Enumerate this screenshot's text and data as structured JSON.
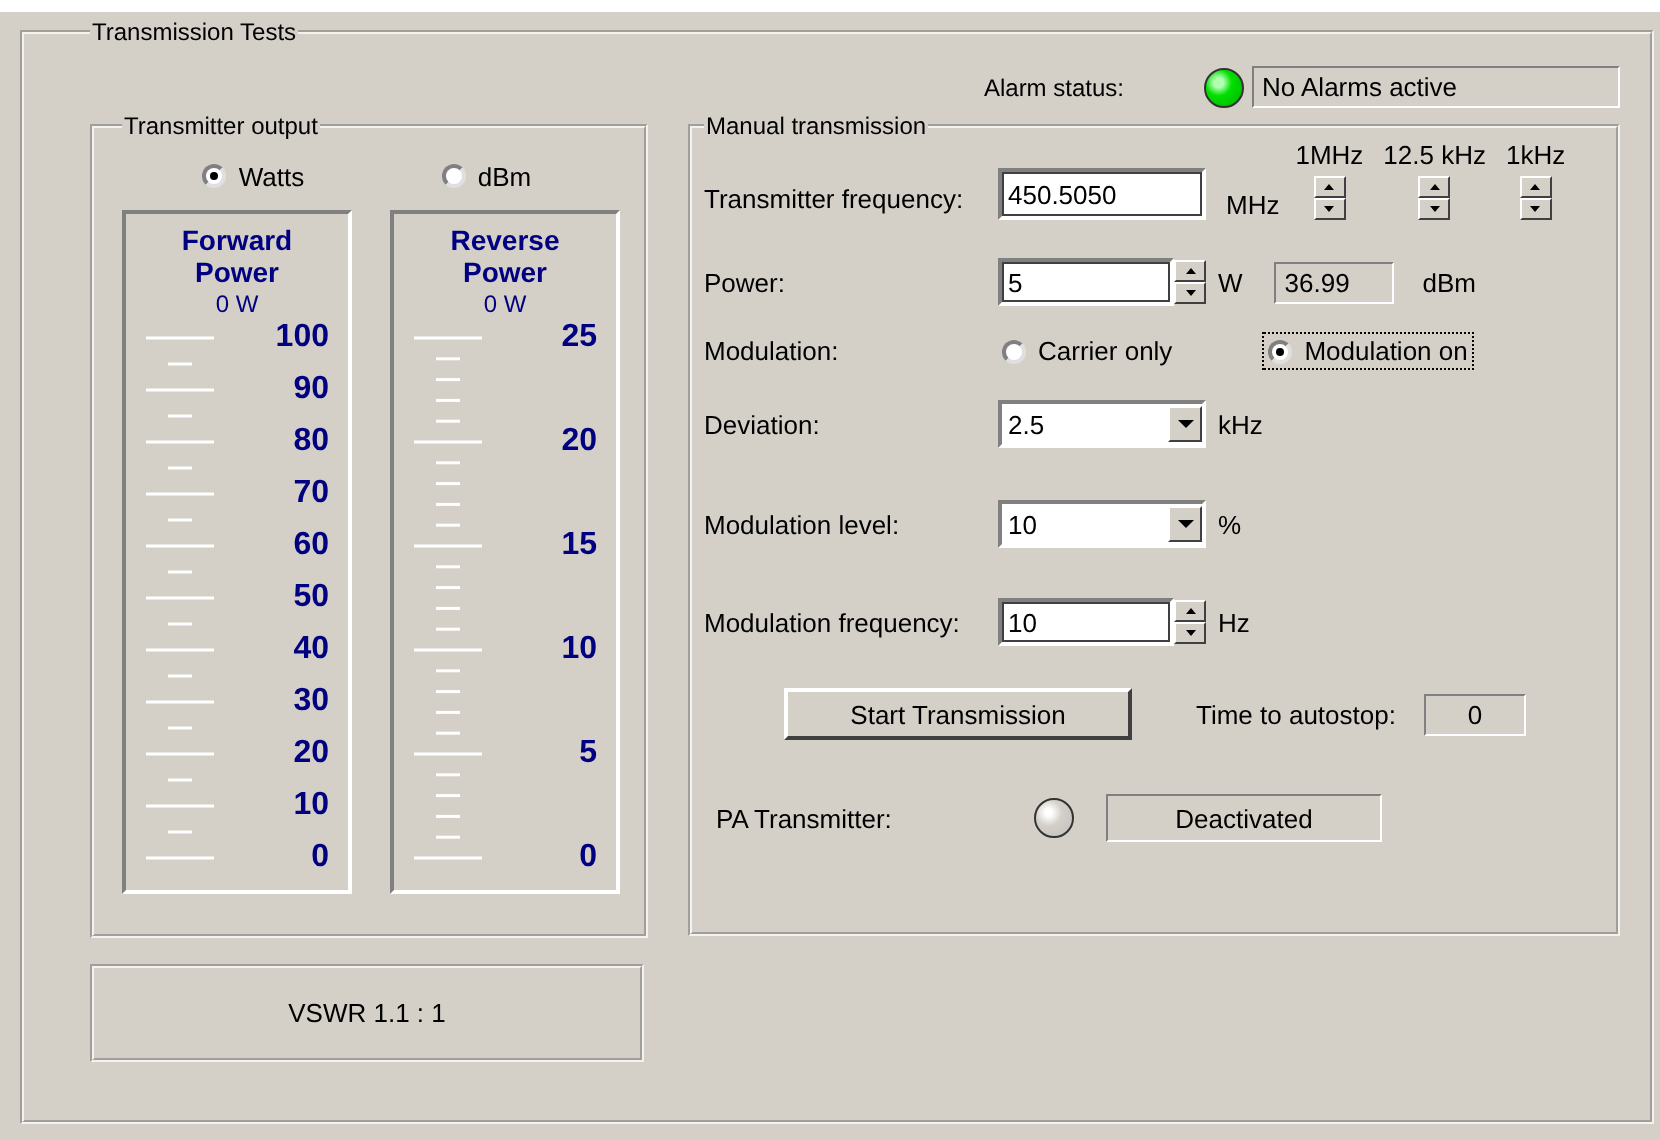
{
  "window": {
    "title": "Transmission Tests"
  },
  "alarm": {
    "label": "Alarm status:",
    "on": true,
    "text": "No Alarms active"
  },
  "transmitter_output": {
    "title": "Transmitter output",
    "units": [
      {
        "label": "Watts",
        "selected": true
      },
      {
        "label": "dBm",
        "selected": false
      }
    ],
    "meters": [
      {
        "title": "Forward Power",
        "reading": "0 W",
        "scale": [
          "100",
          "90",
          "80",
          "70",
          "60",
          "50",
          "40",
          "30",
          "20",
          "10",
          "0"
        ]
      },
      {
        "title": "Reverse Power",
        "reading": "0 W",
        "scale": [
          "25",
          "20",
          "15",
          "10",
          "5",
          "0"
        ]
      }
    ]
  },
  "vswr": "VSWR 1.1 : 1",
  "manual": {
    "title": "Manual transmission",
    "frequency": {
      "label": "Transmitter frequency:",
      "value": "450.5050",
      "unit": "MHz",
      "steps": [
        "1MHz",
        "12.5 kHz",
        "1kHz"
      ]
    },
    "power": {
      "label": "Power:",
      "value": "5",
      "unit": "W",
      "dbm_value": "36.99",
      "dbm_unit": "dBm"
    },
    "modulation": {
      "label": "Modulation:",
      "options": [
        {
          "label": "Carrier only",
          "selected": false
        },
        {
          "label": "Modulation on",
          "selected": true
        }
      ]
    },
    "deviation": {
      "label": "Deviation:",
      "value": "2.5",
      "unit": "kHz"
    },
    "modulation_level": {
      "label": "Modulation level:",
      "value": "10",
      "unit": "%"
    },
    "modulation_frequency": {
      "label": "Modulation frequency:",
      "value": "10",
      "unit": "Hz"
    },
    "start_button": "Start Transmission",
    "autostop": {
      "label": "Time to autostop:",
      "value": "0"
    },
    "pa": {
      "label": "PA Transmitter:",
      "on": false,
      "text": "Deactivated"
    }
  }
}
